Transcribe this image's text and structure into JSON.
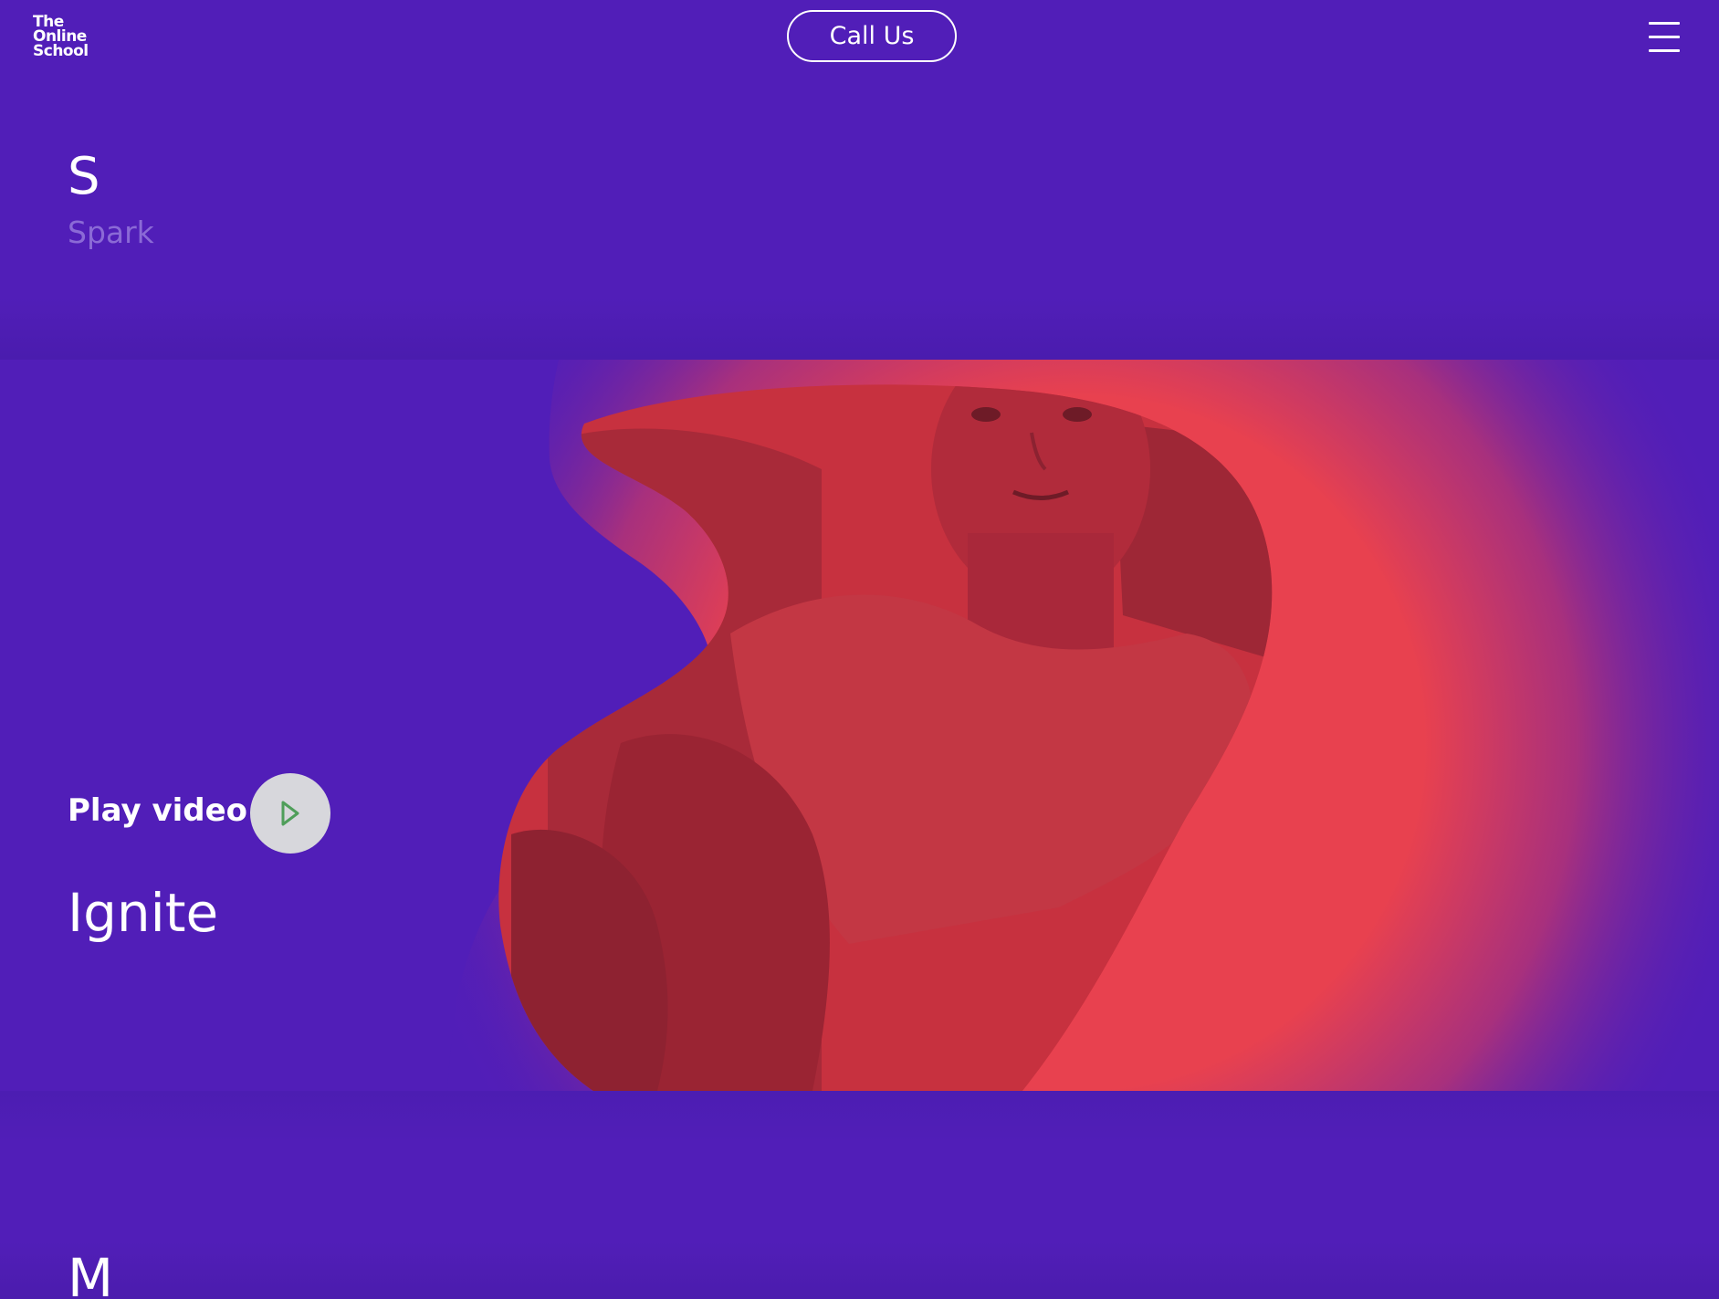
{
  "header": {
    "logo": [
      "The",
      "Online",
      "School"
    ],
    "call_label": "Call Us",
    "menu_icon": "hamburger-menu-icon"
  },
  "spark_section": {
    "letter": "S",
    "label": "Spark"
  },
  "hero": {
    "play_label": "Play video",
    "title": "Ignite",
    "play_icon": "play-icon"
  },
  "next_section": {
    "letter": "M"
  },
  "colors": {
    "background": "#511eb8",
    "accent": "#e8414f",
    "muted_text": "#8b6ad6",
    "play_button": "#d7d7dc",
    "play_icon": "#4f9e5a"
  }
}
